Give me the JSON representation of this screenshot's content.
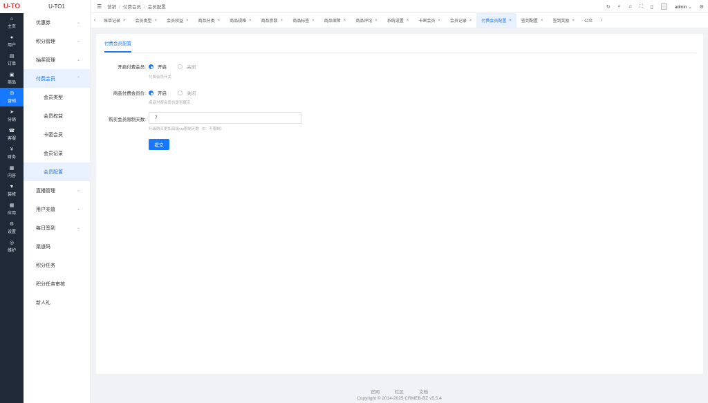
{
  "logo": "U-TO",
  "rail": [
    {
      "icon": "⌂",
      "label": "主页"
    },
    {
      "icon": "●",
      "label": "用户"
    },
    {
      "icon": "▤",
      "label": "订单"
    },
    {
      "icon": "▣",
      "label": "商品"
    },
    {
      "icon": "✉",
      "label": "营销"
    },
    {
      "icon": "➤",
      "label": "分销"
    },
    {
      "icon": "☎",
      "label": "客服"
    },
    {
      "icon": "¥",
      "label": "财务"
    },
    {
      "icon": "▦",
      "label": "内容"
    },
    {
      "icon": "▼",
      "label": "装修"
    },
    {
      "icon": "▦",
      "label": "应用"
    },
    {
      "icon": "⚙",
      "label": "设置"
    },
    {
      "icon": "◎",
      "label": "维护"
    }
  ],
  "submenu": {
    "title": "U-TO1",
    "items": [
      {
        "label": "优惠券",
        "chev": "⌄"
      },
      {
        "label": "积分管理",
        "chev": "⌄"
      },
      {
        "label": "抽奖管理",
        "chev": "⌄"
      },
      {
        "label": "付费会员",
        "chev": "⌃"
      },
      {
        "label": "会员类型",
        "chev": ""
      },
      {
        "label": "会员权益",
        "chev": ""
      },
      {
        "label": "卡密会员",
        "chev": ""
      },
      {
        "label": "会员记录",
        "chev": ""
      },
      {
        "label": "会员配置",
        "chev": ""
      },
      {
        "label": "直播管理",
        "chev": "⌄"
      },
      {
        "label": "用户充值",
        "chev": "⌄"
      },
      {
        "label": "每日签到",
        "chev": "⌄"
      },
      {
        "label": "渠道码",
        "chev": ""
      },
      {
        "label": "积分任务",
        "chev": ""
      },
      {
        "label": "积分任务审核",
        "chev": ""
      },
      {
        "label": "新人礼",
        "chev": ""
      }
    ]
  },
  "header": {
    "breadcrumb": [
      "营销",
      "付费会员",
      "会员配置"
    ],
    "separator": "/",
    "user": "admin"
  },
  "tabs": {
    "left_arrow": "‹",
    "right_arrow": "›",
    "items": [
      "账单记录",
      "会员类型",
      "会员权益",
      "商品分类",
      "商品规格",
      "商品参数",
      "商品标签",
      "商品保障",
      "商品评论",
      "系统设置",
      "卡密会员",
      "会员记录",
      "付费会员配置",
      "签到配置",
      "签到奖励",
      "公众"
    ],
    "close": "×"
  },
  "form": {
    "tab_label": "付费会员配置",
    "fields": [
      {
        "label": "开启付费会员:",
        "on": "开启",
        "off": "关闭",
        "hint": "付费会员开关"
      },
      {
        "label": "商品付费会员价:",
        "on": "开启",
        "off": "关闭",
        "hint": "商品付费会员价是否展示"
      }
    ],
    "days_label": "购买会员限制天数:",
    "days_value": "7",
    "days_hint": "升级购买更加高级vip限制天数（0：不限制）",
    "submit": "提交"
  },
  "footer": {
    "links": [
      "官网",
      "社区",
      "文档"
    ],
    "copyright": "Copyright © 2014-2025 CRMEB-BZ v5.5.4"
  }
}
